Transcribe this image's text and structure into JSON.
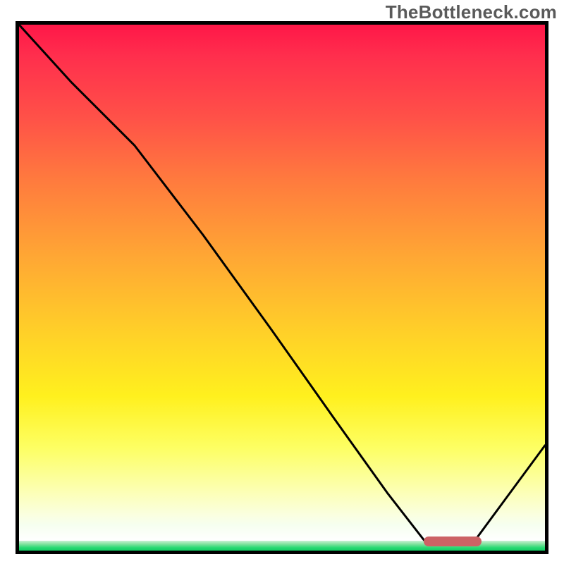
{
  "watermark_text": "TheBottleneck.com",
  "chart_data": {
    "type": "line",
    "title": "",
    "xlabel": "",
    "ylabel": "",
    "xlim": [
      0,
      100
    ],
    "ylim": [
      0,
      100
    ],
    "grid": false,
    "legend": false,
    "series": [
      {
        "name": "bottleneck-curve",
        "x": [
          0,
          10,
          22,
          35,
          48,
          60,
          70,
          77,
          80,
          86,
          100
        ],
        "values": [
          100,
          89,
          77,
          60,
          42,
          25,
          11,
          2,
          1,
          1,
          20
        ]
      }
    ],
    "target_marker": {
      "x_start": 77,
      "x_end": 88,
      "y": 1,
      "color": "#cc6265"
    },
    "gradient_stops": [
      {
        "y": 100,
        "color": "#ff1748"
      },
      {
        "y": 70,
        "color": "#ff7a3e"
      },
      {
        "y": 40,
        "color": "#ffd128"
      },
      {
        "y": 10,
        "color": "#fcffb0"
      },
      {
        "y": 0,
        "color": "#14cd63"
      }
    ]
  }
}
